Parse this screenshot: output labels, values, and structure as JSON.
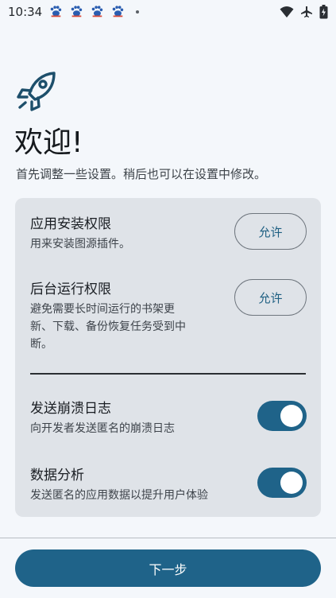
{
  "status_bar": {
    "time": "10:34"
  },
  "header": {
    "title": "欢迎!",
    "subtitle": "首先调整一些设置。稍后也可以在设置中修改。"
  },
  "permissions": [
    {
      "title": "应用安装权限",
      "description": "用来安装图源插件。",
      "button": "允许"
    },
    {
      "title": "后台运行权限",
      "description_lines": [
        "避免需要长时间运行的书架更",
        "新、下载、备份恢复任务受到中",
        "断。"
      ],
      "button": "允许"
    }
  ],
  "toggles": [
    {
      "title": "发送崩溃日志",
      "description": "向开发者发送匿名的崩溃日志",
      "enabled": true
    },
    {
      "title": "数据分析",
      "description": "发送匿名的应用数据以提升用户体验",
      "enabled": true
    }
  ],
  "footer": {
    "next_label": "下一步"
  },
  "colors": {
    "accent": "#1f6389",
    "card_bg": "#dfe3e8",
    "page_bg": "#f4f7fb"
  }
}
